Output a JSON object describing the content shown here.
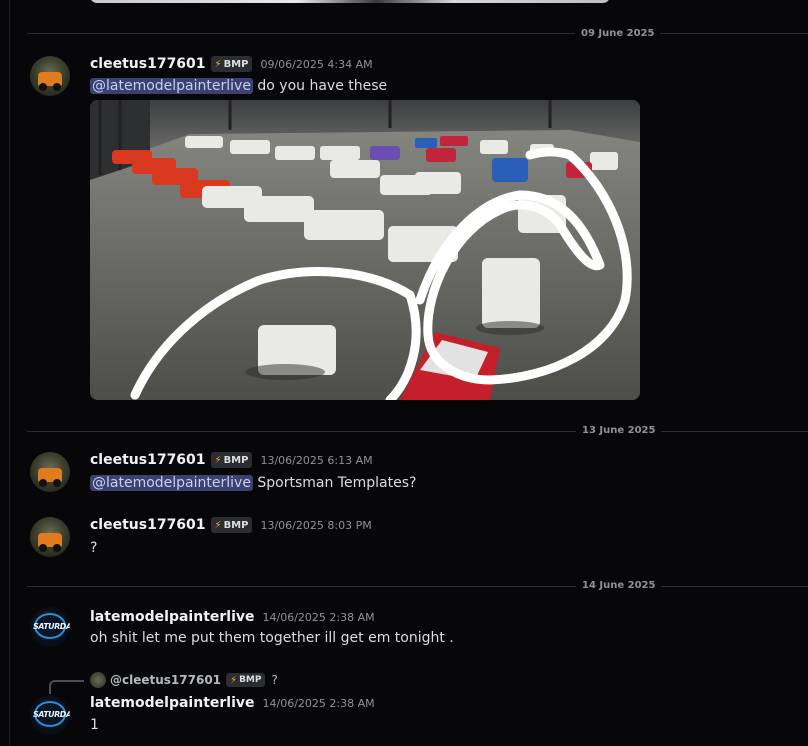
{
  "dividers": [
    "09 June 2025",
    "13 June 2025",
    "14 June 2025"
  ],
  "badge_label": "BMP",
  "messages": [
    {
      "username": "cleetus177601",
      "timestamp": "09/06/2025 4:34 AM",
      "mention": "@latemodelpainterlive",
      "text": "do you have these"
    },
    {
      "username": "cleetus177601",
      "timestamp": "13/06/2025 6:13 AM",
      "mention": "@latemodelpainterlive",
      "text": "Sportsman Templates?"
    },
    {
      "username": "cleetus177601",
      "timestamp": "13/06/2025 8:03 PM",
      "text": "?"
    },
    {
      "username": "latemodelpainterlive",
      "timestamp": "14/06/2025 2:38 AM",
      "text": "oh shit let me put them together ill get em tonight ."
    },
    {
      "username": "latemodelpainterlive",
      "timestamp": "14/06/2025 2:38 AM",
      "text": "1",
      "reply": {
        "username": "@cleetus177601",
        "text": "?"
      }
    }
  ],
  "avatar_text": "SATURDAY"
}
